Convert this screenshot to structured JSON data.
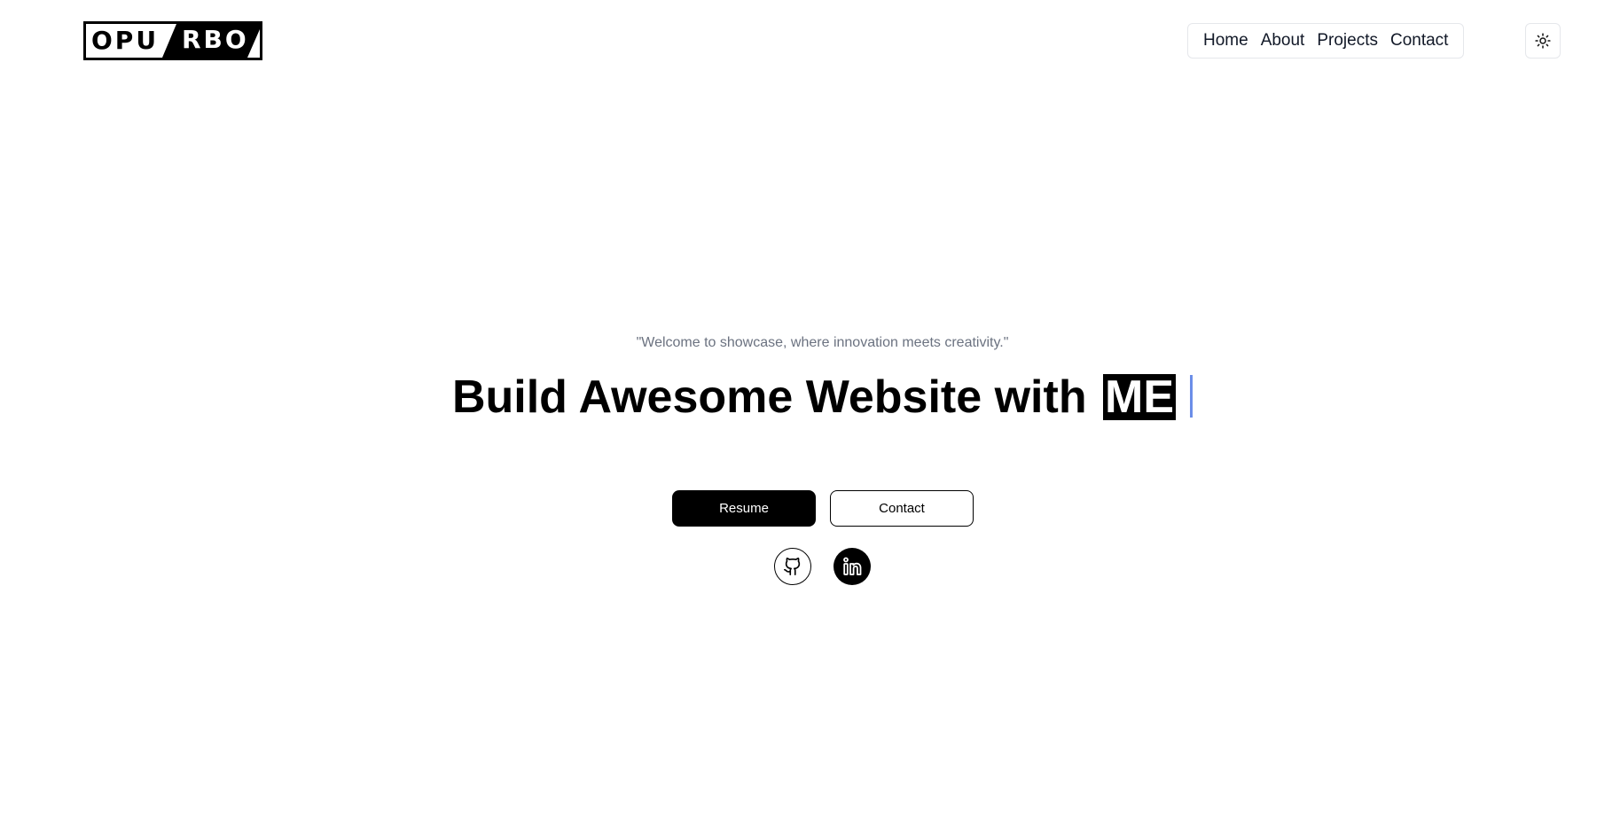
{
  "header": {
    "logo": {
      "left": "OPU",
      "right": "RBO"
    },
    "nav": [
      {
        "label": "Home"
      },
      {
        "label": "About"
      },
      {
        "label": "Projects"
      },
      {
        "label": "Contact"
      }
    ],
    "theme_toggle_icon": "sun-icon"
  },
  "hero": {
    "tagline": "\"Welcome to showcase, where innovation meets creativity.\"",
    "headline": "Build Awesome Website with",
    "headline_highlight": "ME",
    "buttons": {
      "resume": "Resume",
      "contact": "Contact"
    },
    "social": [
      {
        "icon": "github-icon"
      },
      {
        "icon": "linkedin-icon"
      }
    ]
  },
  "colors": {
    "primary": "#000000",
    "background": "#ffffff",
    "muted_text": "#6b7280",
    "cursor": "#6b8ee8"
  }
}
